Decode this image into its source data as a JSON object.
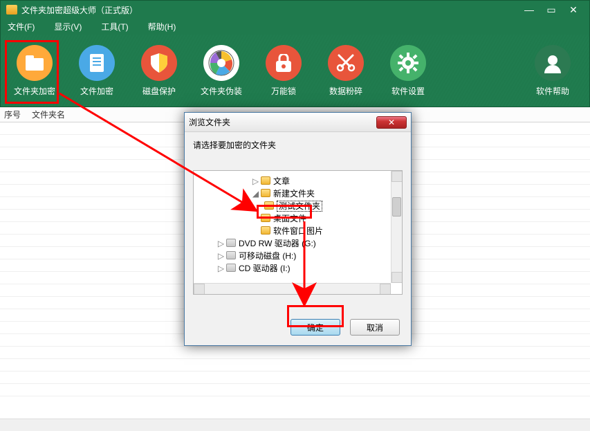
{
  "window": {
    "title": "文件夹加密超级大师（正式版）"
  },
  "menu": {
    "file": "文件(F)",
    "view": "显示(V)",
    "tools": "工具(T)",
    "help": "帮助(H)"
  },
  "toolbar": {
    "folder_encrypt": "文件夹加密",
    "file_encrypt": "文件加密",
    "disk_protect": "磁盘保护",
    "folder_disguise": "文件夹伪装",
    "universal_lock": "万能锁",
    "data_shred": "数据粉碎",
    "software_settings": "软件设置",
    "software_help": "软件帮助"
  },
  "table": {
    "col_index": "序号",
    "col_name": "文件夹名"
  },
  "dialog": {
    "title": "浏览文件夹",
    "prompt": "请选择要加密的文件夹",
    "ok": "确定",
    "cancel": "取消",
    "tree": {
      "n1": "文章",
      "n2": "新建文件夹",
      "n3": "测试文件夹",
      "n4": "桌面文件",
      "n5": "软件窗口图片",
      "d1": "DVD RW 驱动器 (G:)",
      "d2": "可移动磁盘 (H:)",
      "d3": "CD 驱动器 (I:)"
    }
  },
  "colors": {
    "accent_red": "#ff0000"
  }
}
